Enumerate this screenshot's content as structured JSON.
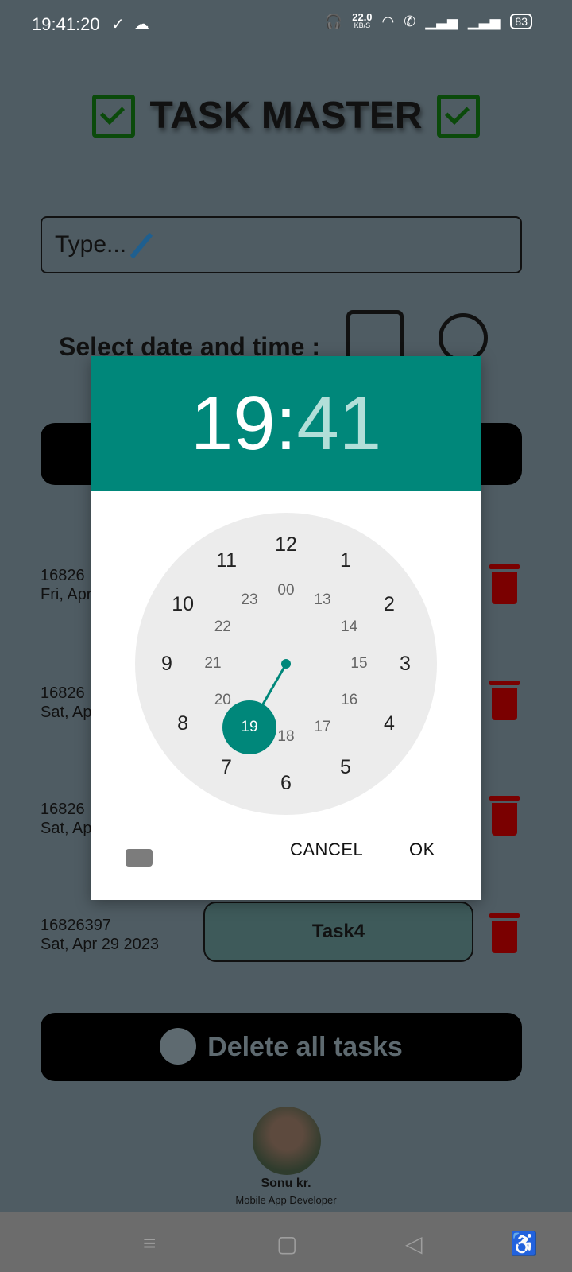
{
  "status": {
    "time": "19:41:20",
    "speed_value": "22.0",
    "speed_unit": "KB/S",
    "battery": "83"
  },
  "header": {
    "title": "TASK MASTER"
  },
  "input": {
    "value": "Type..."
  },
  "date_section": {
    "label": "Select date and time :"
  },
  "tasks": [
    {
      "id": "16826",
      "date": "Fri, Apr",
      "label": ""
    },
    {
      "id": "16826",
      "date": "Sat, Ap",
      "label": ""
    },
    {
      "id": "16826",
      "date": "Sat, Ap",
      "label": ""
    },
    {
      "id": "16826397",
      "date": "Sat, Apr 29 2023",
      "label": "Task4"
    }
  ],
  "delete_all": {
    "label": "Delete all tasks"
  },
  "developer": {
    "name": "Sonu kr.",
    "role": "Mobile App Developer"
  },
  "time_picker": {
    "hour": "19",
    "separator": ":",
    "minute": "41",
    "selected_hour": "19",
    "outer_numbers": [
      "12",
      "1",
      "2",
      "3",
      "4",
      "5",
      "6",
      "7",
      "8",
      "9",
      "10",
      "11"
    ],
    "inner_numbers": [
      "00",
      "13",
      "14",
      "15",
      "16",
      "17",
      "18",
      "19",
      "20",
      "21",
      "22",
      "23"
    ],
    "cancel_label": "CANCEL",
    "ok_label": "OK"
  },
  "colors": {
    "accent": "#00877a",
    "background": "#4f5c63",
    "trash": "#7a0000"
  }
}
